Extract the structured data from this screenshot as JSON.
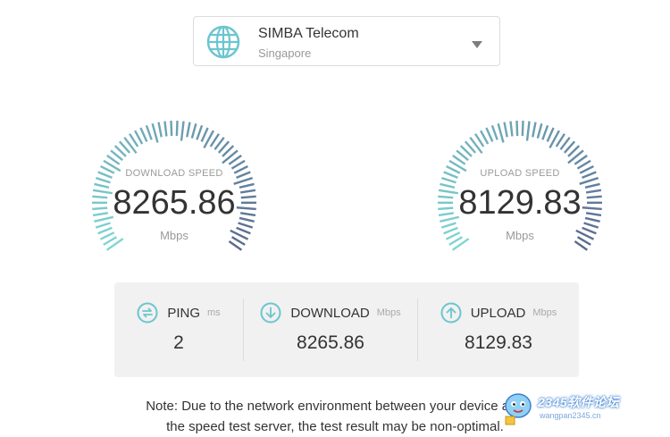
{
  "server": {
    "name": "SIMBA Telecom",
    "location": "Singapore",
    "icon": "globe-icon",
    "accent": "#6cc5cf"
  },
  "gauges": {
    "download": {
      "label": "DOWNLOAD SPEED",
      "value": "8265.86",
      "unit": "Mbps"
    },
    "upload": {
      "label": "UPLOAD SPEED",
      "value": "8129.83",
      "unit": "Mbps"
    },
    "colors": {
      "start": "#7fd7d3",
      "end": "#5b6a90"
    }
  },
  "stats": {
    "ping": {
      "title": "PING",
      "unit": "ms",
      "value": "2",
      "icon": "ping-icon"
    },
    "download": {
      "title": "DOWNLOAD",
      "unit": "Mbps",
      "value": "8265.86",
      "icon": "download-arrow-icon"
    },
    "upload": {
      "title": "UPLOAD",
      "unit": "Mbps",
      "value": "8129.83",
      "icon": "upload-arrow-icon"
    }
  },
  "note": {
    "line1": "Note: Due to the network environment between your device and",
    "line2": "the speed test server, the test result may be non-optimal."
  },
  "watermark": {
    "text": "2345软件论坛",
    "url": "wangpan2345.cn"
  }
}
